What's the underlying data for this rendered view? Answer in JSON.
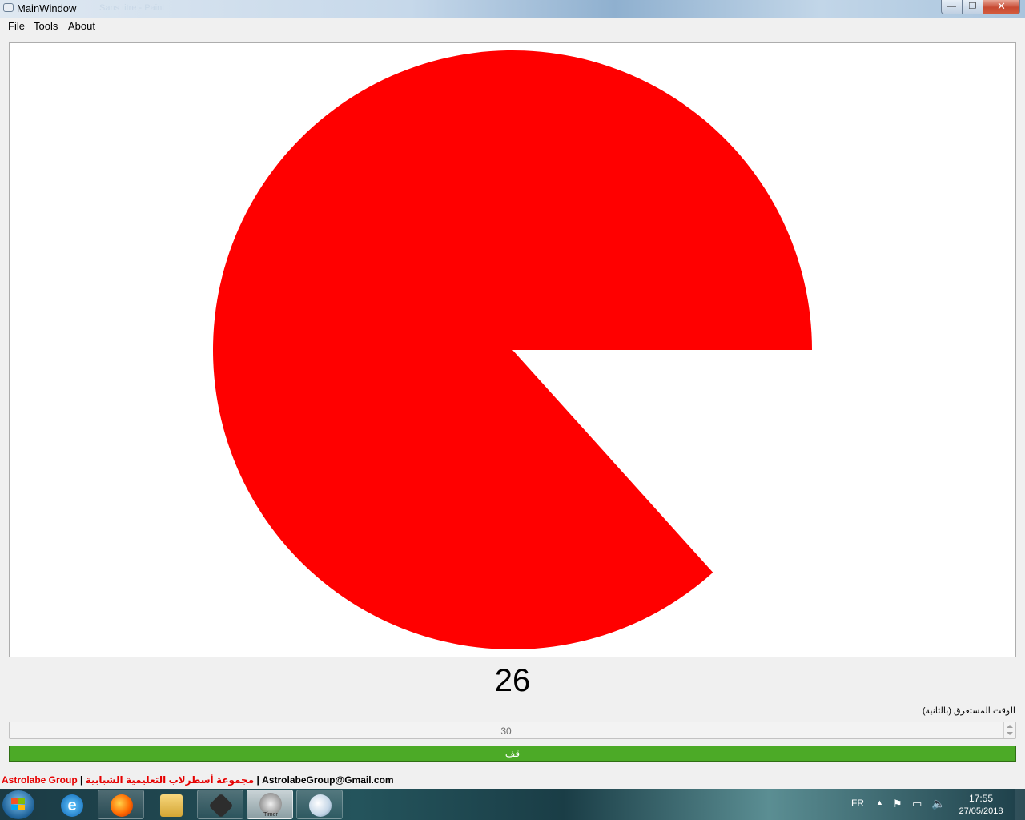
{
  "window": {
    "title": "MainWindow",
    "background_title": "Sans titre - Paint",
    "minimize": "—",
    "maximize": "❐",
    "close": "✕"
  },
  "menu": {
    "file": "File",
    "tools": "Tools",
    "about": "About"
  },
  "timer": {
    "counter": "26",
    "total_seconds": 30,
    "remaining_fraction": 0.8667,
    "pie_color": "#ff0000",
    "elapsed_label": "الوقت المستغرق (بالثانية)",
    "duration_value": "30",
    "stop_label": "قف",
    "stop_color": "#4caa27"
  },
  "footer": {
    "brand_en": "Astrolabe Group",
    "separator": " | ",
    "brand_ar": "مجموعة أسطرلاب التعليمية الشبابية",
    "email": "AstrolabeGroup@Gmail.com"
  },
  "taskbar": {
    "apps": [
      {
        "name": "Internet Explorer",
        "icon": "ie-icon"
      },
      {
        "name": "Firefox",
        "icon": "firefox-icon"
      },
      {
        "name": "Explorer",
        "icon": "folder-icon"
      },
      {
        "name": "Git",
        "icon": "git-icon"
      },
      {
        "name": "Timer",
        "icon": "timer-icon",
        "caption": "Timer",
        "active": true
      },
      {
        "name": "Paint",
        "icon": "paint-icon"
      }
    ],
    "language": "FR",
    "time": "17:55",
    "date": "27/05/2018"
  }
}
